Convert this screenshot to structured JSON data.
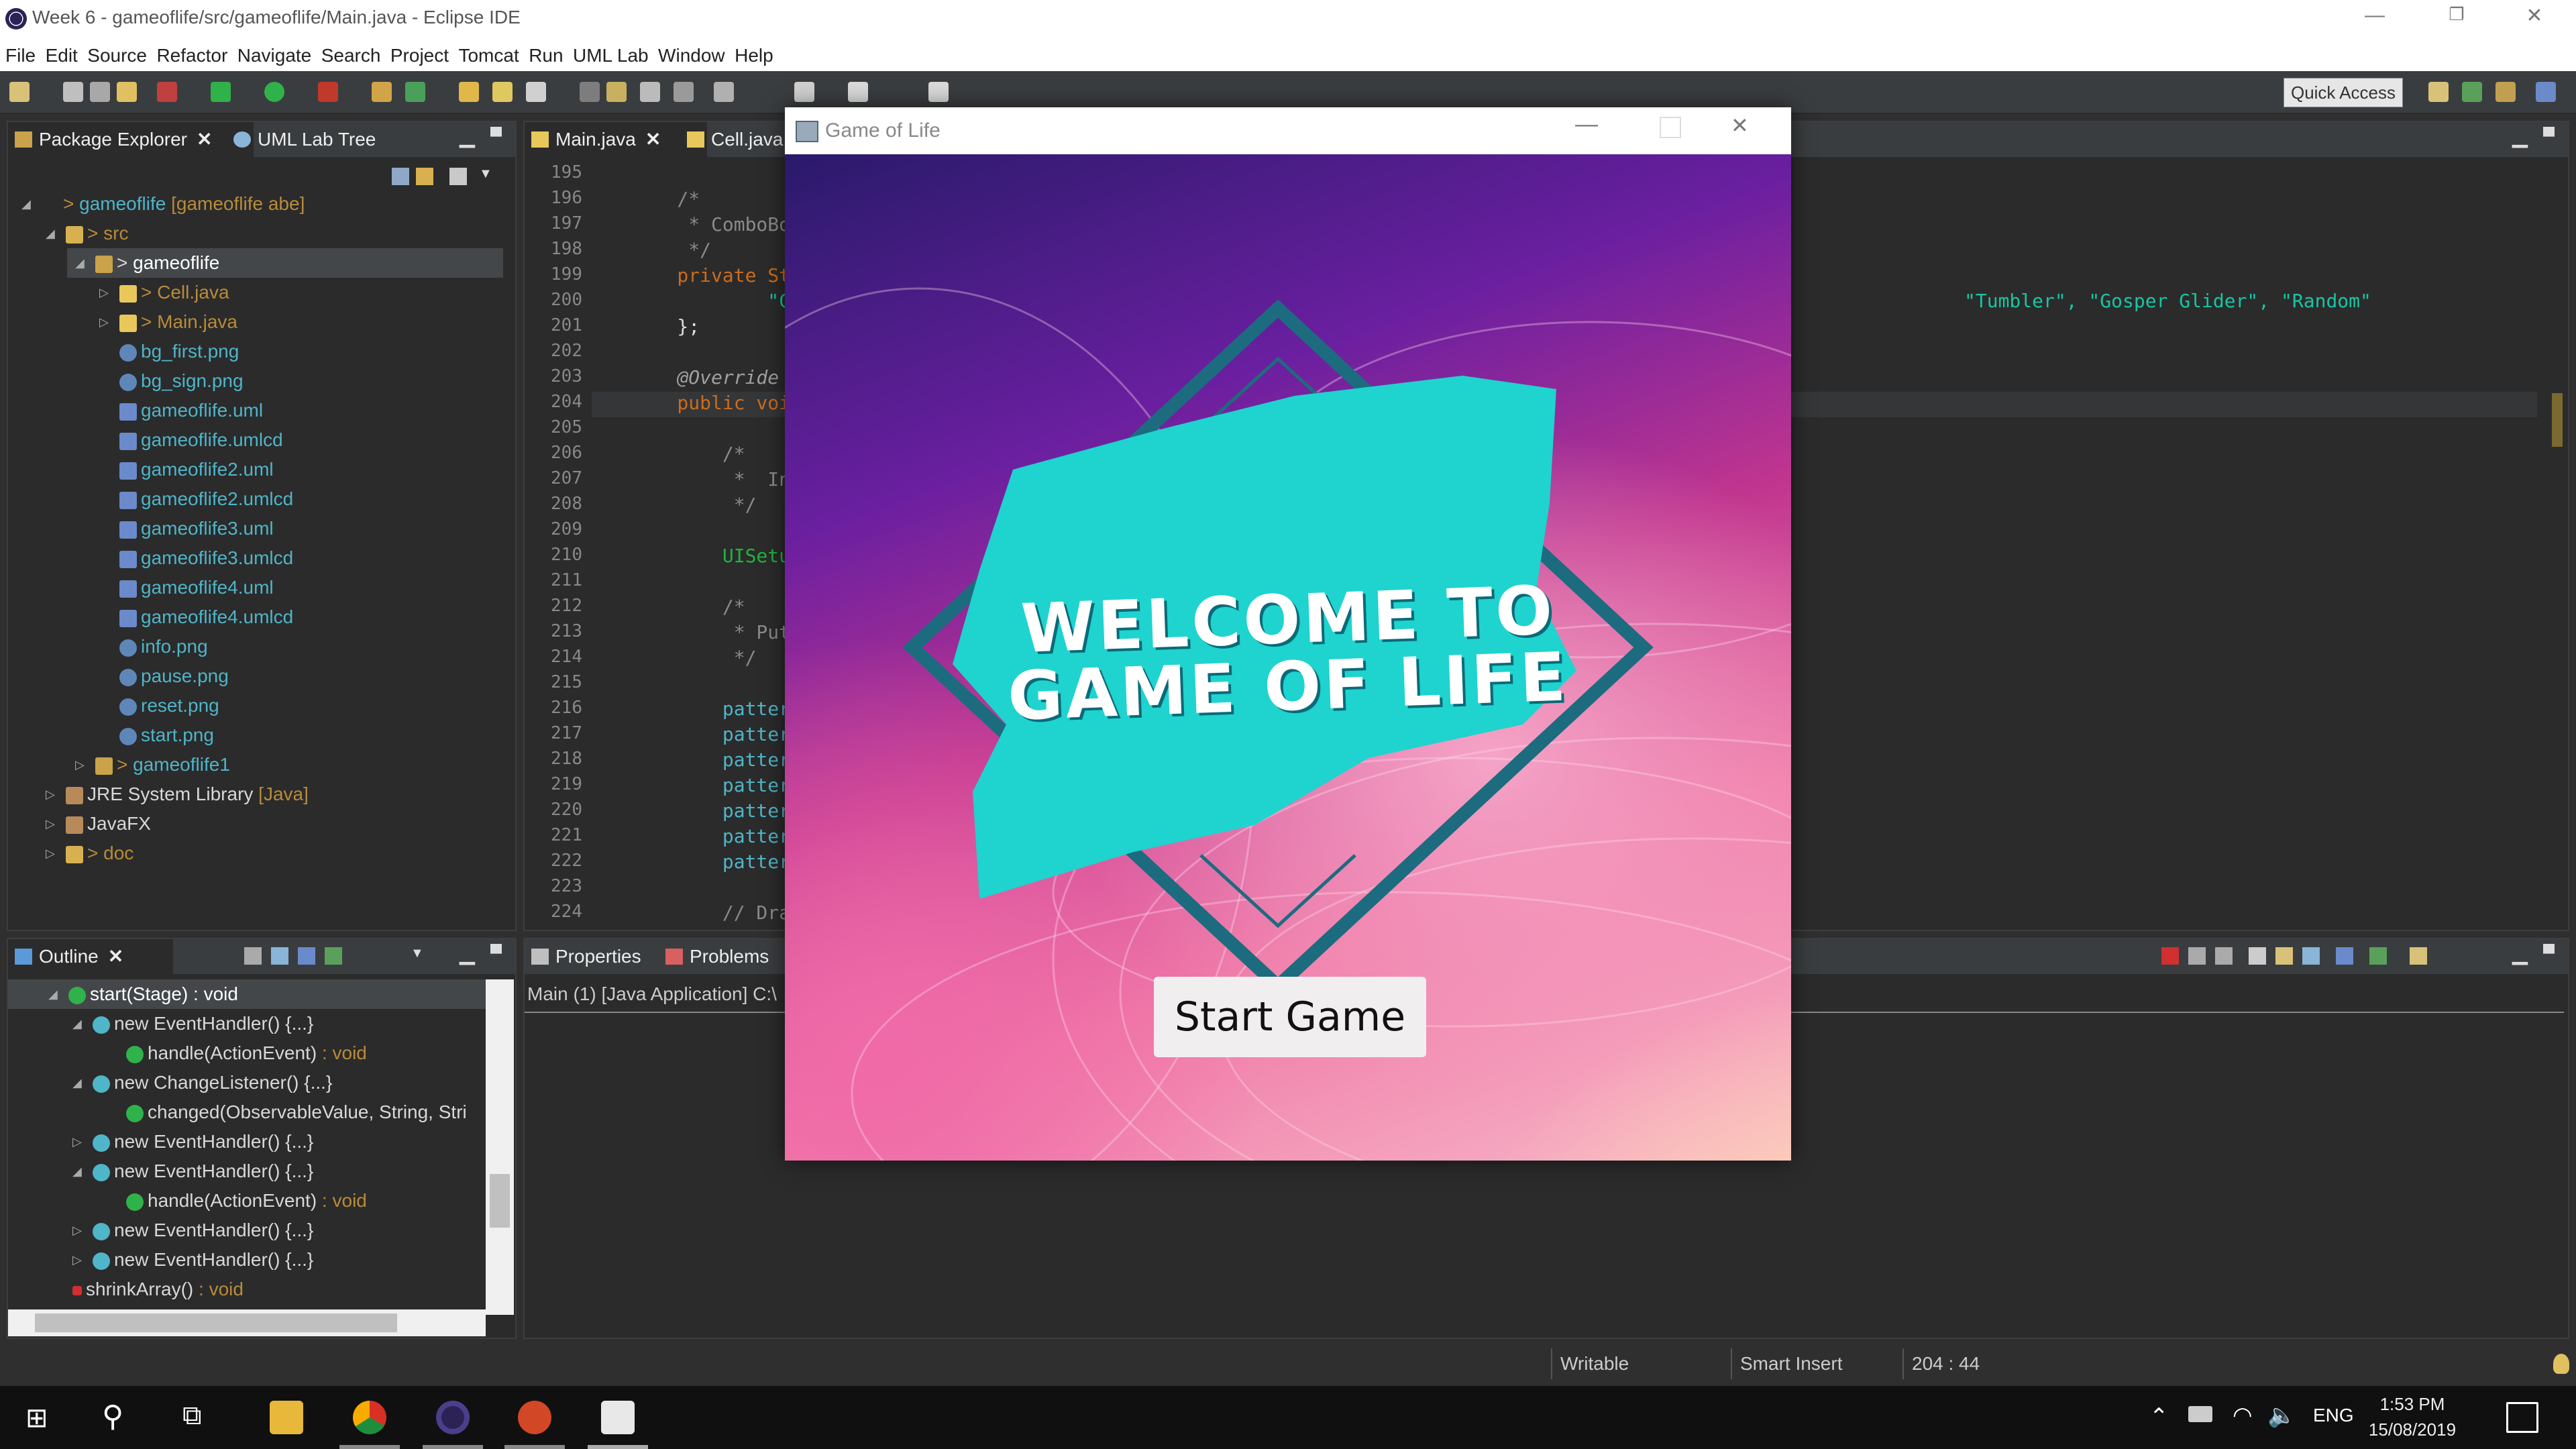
{
  "window": {
    "title": "Week 6 - gameoflife/src/gameoflife/Main.java - Eclipse IDE",
    "minimize": "—",
    "restore": "❐",
    "close": "✕"
  },
  "menu": [
    "File",
    "Edit",
    "Source",
    "Refactor",
    "Navigate",
    "Search",
    "Project",
    "Tomcat",
    "Run",
    "UML Lab",
    "Window",
    "Help"
  ],
  "toolbar": {
    "quick_access": "Quick Access"
  },
  "package_explorer": {
    "tabs": [
      {
        "label": "Package Explorer",
        "close": "✕"
      },
      {
        "label": "UML Lab Tree"
      }
    ],
    "tree": [
      {
        "prefix": "> ",
        "label": "gameoflife",
        "decoration": " [gameoflife abe]"
      },
      {
        "prefix": "> ",
        "label": "src"
      },
      {
        "prefix": "> ",
        "label": "gameoflife"
      },
      {
        "prefix": "> ",
        "label": "Cell.java"
      },
      {
        "prefix": "> ",
        "label": "Main.java"
      },
      {
        "label": "bg_first.png"
      },
      {
        "label": "bg_sign.png"
      },
      {
        "label": "gameoflife.uml"
      },
      {
        "label": "gameoflife.umlcd"
      },
      {
        "label": "gameoflife2.uml"
      },
      {
        "label": "gameoflife2.umlcd"
      },
      {
        "label": "gameoflife3.uml"
      },
      {
        "label": "gameoflife3.umlcd"
      },
      {
        "label": "gameoflife4.uml"
      },
      {
        "label": "gameoflife4.umlcd"
      },
      {
        "label": "info.png"
      },
      {
        "label": "pause.png"
      },
      {
        "label": "reset.png"
      },
      {
        "label": "start.png"
      },
      {
        "prefix": "> ",
        "label": "gameoflife1"
      },
      {
        "label": "JRE System Library",
        "decoration": " [Java]"
      },
      {
        "label": "JavaFX"
      },
      {
        "prefix": "> ",
        "label": "doc"
      }
    ]
  },
  "outline": {
    "tab": {
      "label": "Outline",
      "close": "✕"
    },
    "items": [
      {
        "label": "start(Stage) : void"
      },
      {
        "label": "new EventHandler() {...}"
      },
      {
        "label": "handle(ActionEvent)",
        "type": " : void"
      },
      {
        "label": "new ChangeListener() {...}"
      },
      {
        "label": "changed(ObservableValue, String, Stri"
      },
      {
        "label": "new EventHandler() {...}"
      },
      {
        "label": "new EventHandler() {...}"
      },
      {
        "label": "handle(ActionEvent)",
        "type": " : void"
      },
      {
        "label": "new EventHandler() {...}"
      },
      {
        "label": "new EventHandler() {...}"
      },
      {
        "label": "shrinkArray()",
        "type": " : void"
      }
    ]
  },
  "editor": {
    "tabs": [
      {
        "label": "Main.java",
        "close": "✕"
      },
      {
        "label": "Cell.java"
      }
    ],
    "lines": [
      {
        "n": "195",
        "t": ""
      },
      {
        "n": "196",
        "t": "    /*"
      },
      {
        "n": "197",
        "t": "     * ComboBox"
      },
      {
        "n": "198",
        "t": "     */"
      },
      {
        "n": "199",
        "t": "    private Stri"
      },
      {
        "n": "200",
        "t": "            \"Cle"
      },
      {
        "n": "201",
        "t": "    };"
      },
      {
        "n": "202",
        "t": ""
      },
      {
        "n": "203",
        "t": "    @Override"
      },
      {
        "n": "204",
        "t": "    public void"
      },
      {
        "n": "205",
        "t": ""
      },
      {
        "n": "206",
        "t": "        /*"
      },
      {
        "n": "207",
        "t": "         *  Init"
      },
      {
        "n": "208",
        "t": "         */"
      },
      {
        "n": "209",
        "t": ""
      },
      {
        "n": "210",
        "t": "        UISetup("
      },
      {
        "n": "211",
        "t": ""
      },
      {
        "n": "212",
        "t": "        /*"
      },
      {
        "n": "213",
        "t": "         * Put c"
      },
      {
        "n": "214",
        "t": "         */"
      },
      {
        "n": "215",
        "t": ""
      },
      {
        "n": "216",
        "t": "        patterns"
      },
      {
        "n": "217",
        "t": "        patterns"
      },
      {
        "n": "218",
        "t": "        patterns"
      },
      {
        "n": "219",
        "t": "        patterns"
      },
      {
        "n": "220",
        "t": "        patterns"
      },
      {
        "n": "221",
        "t": "        patterns"
      },
      {
        "n": "222",
        "t": "        patterns"
      },
      {
        "n": "223",
        "t": ""
      },
      {
        "n": "224",
        "t": "        // Draw"
      }
    ],
    "overflow_line_200": "\"Tumbler\", \"Gosper Glider\", \"Random\""
  },
  "bottom_panel": {
    "tabs": [
      {
        "label": "Properties"
      },
      {
        "label": "Problems"
      }
    ],
    "console_title": "Main (1) [Java Application] C:\\"
  },
  "status": {
    "writable": "Writable",
    "insert_mode": "Smart Insert",
    "position": "204 : 44"
  },
  "game_window": {
    "title": "Game of Life",
    "heading_line1": "Welcome to",
    "heading_line2": "Game of Life",
    "start_button": "Start Game"
  },
  "taskbar": {
    "language": "ENG",
    "time": "1:53 PM",
    "date": "15/08/2019"
  },
  "colors": {
    "accent_teal": "#1fd3cf",
    "diamond": "#1d6b7f",
    "ide_bg": "#2b2b2b"
  }
}
